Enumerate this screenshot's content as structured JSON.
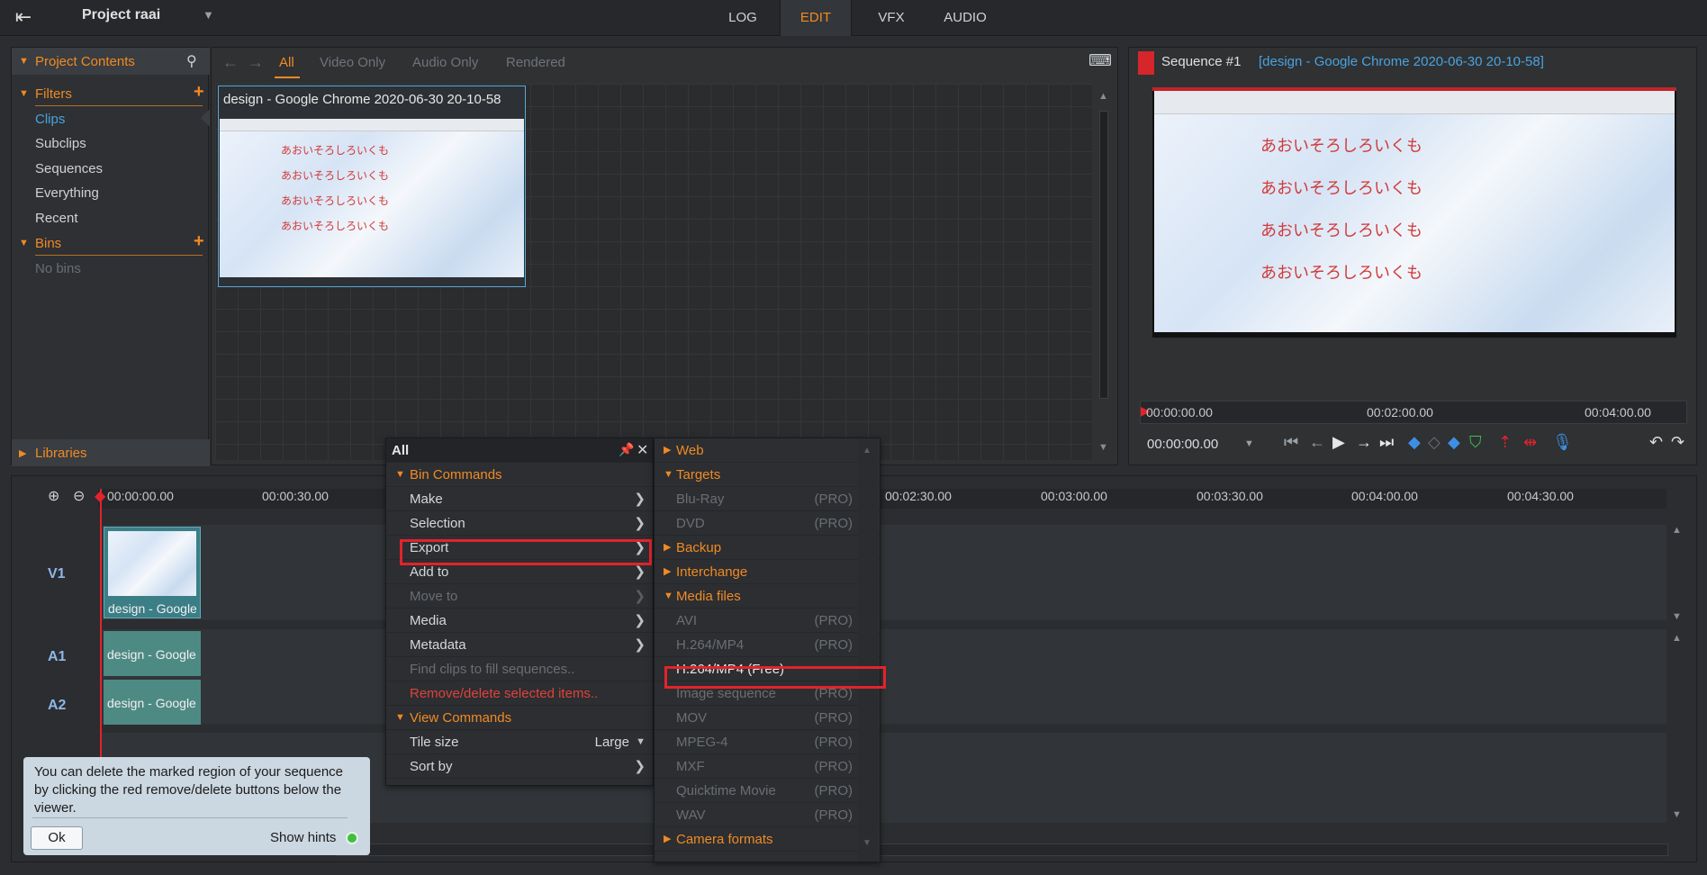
{
  "app": {
    "project_name": "Project raai"
  },
  "main_tabs": [
    "LOG",
    "EDIT",
    "VFX",
    "AUDIO"
  ],
  "left_panel": {
    "title": "Project Contents",
    "filters_label": "Filters",
    "filters": [
      "Clips",
      "Subclips",
      "Sequences",
      "Everything",
      "Recent"
    ],
    "bins_label": "Bins",
    "no_bins": "No bins",
    "libraries_label": "Libraries"
  },
  "browser": {
    "filter_tabs": [
      "All",
      "Video Only",
      "Audio Only",
      "Rendered"
    ],
    "clip_title": "design - Google Chrome 2020-06-30 20-10-58",
    "clip_text": "あおいそろしろいくも"
  },
  "viewer": {
    "sequence_label": "Sequence #1",
    "clip_label": "[design - Google Chrome 2020-06-30 20-10-58]",
    "preview_text": "あおいそろしろいくも",
    "ruler": [
      "00:00:00.00",
      "00:02:00.00",
      "00:04:00.00"
    ],
    "timecode": "00:00:00.00"
  },
  "timeline": {
    "ruler": [
      "00:00:00.00",
      "00:00:30.00",
      "00:02:30.00",
      "00:03:00.00",
      "00:03:30.00",
      "00:04:00.00",
      "00:04:30.00"
    ],
    "tracks": {
      "v1": "V1",
      "a1": "A1",
      "a2": "A2"
    },
    "clip_name": "design - Google"
  },
  "context_menu": {
    "title": "All",
    "bin_commands": "Bin Commands",
    "items": [
      {
        "label": "Make",
        "disabled": false
      },
      {
        "label": "Selection",
        "disabled": false
      },
      {
        "label": "Export",
        "disabled": false
      },
      {
        "label": "Add to",
        "disabled": false
      },
      {
        "label": "Move to",
        "disabled": true
      },
      {
        "label": "Media",
        "disabled": false
      },
      {
        "label": "Metadata",
        "disabled": false
      }
    ],
    "find_clips": "Find clips to fill sequences..",
    "remove": "Remove/delete selected items..",
    "view_commands": "View Commands",
    "tile_size_label": "Tile size",
    "tile_size_value": "Large",
    "sort_by": "Sort by"
  },
  "export_menu": {
    "web": "Web",
    "targets": "Targets",
    "bluray": "Blu-Ray",
    "dvd": "DVD",
    "backup": "Backup",
    "interchange": "Interchange",
    "media_files": "Media files",
    "avi": "AVI",
    "h264_pro": "H.264/MP4",
    "h264_free": "H.264/MP4 (Free)",
    "image_seq": "Image sequence",
    "mov": "MOV",
    "mpeg4": "MPEG-4",
    "mxf": "MXF",
    "quicktime": "Quicktime Movie",
    "wav": "WAV",
    "camera": "Camera formats",
    "pro": "(PRO)"
  },
  "hint": {
    "text": "You can delete the marked region of your sequence by clicking the red remove/delete buttons below the viewer.",
    "ok": "Ok",
    "show_hints": "Show hints"
  },
  "colors": {
    "accent": "#f08a24",
    "highlight": "#e3232b",
    "link": "#4aa3df"
  }
}
